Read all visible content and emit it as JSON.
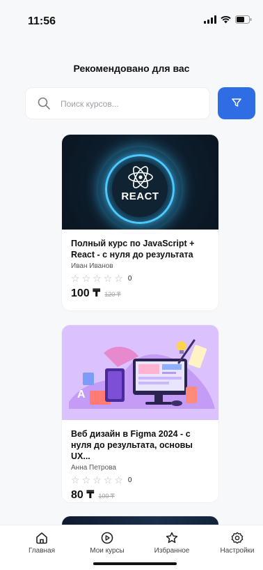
{
  "status": {
    "time": "11:56"
  },
  "header": {
    "title": "Рекомендовано для вас"
  },
  "search": {
    "placeholder": "Поиск курсов..."
  },
  "courses": [
    {
      "thumb_text": "REACT",
      "title": "Полный курс по JavaScript + React - с нуля до результата",
      "author": "Иван Иванов",
      "rating_count": "0",
      "price": "100 ₸",
      "old_price": "120 ₸"
    },
    {
      "title": "Веб дизайн в Figma 2024 - с нуля до результата, основы UX...",
      "author": "Анна Петрова",
      "rating_count": "0",
      "price": "80 ₸",
      "old_price": "100 ₸"
    }
  ],
  "nav": [
    {
      "label": "Главная",
      "icon": "home-icon"
    },
    {
      "label": "Мои курсы",
      "icon": "play-circle-icon"
    },
    {
      "label": "Избранное",
      "icon": "star-icon"
    },
    {
      "label": "Настройки",
      "icon": "gear-icon"
    }
  ],
  "colors": {
    "accent": "#2f6de5",
    "background": "#f7f8fa",
    "star_empty": "#b5b9bf"
  },
  "icons": [
    "search-icon",
    "filter-icon",
    "signal-icon",
    "wifi-icon",
    "battery-icon",
    "react-logo-icon",
    "star-empty-icon"
  ]
}
